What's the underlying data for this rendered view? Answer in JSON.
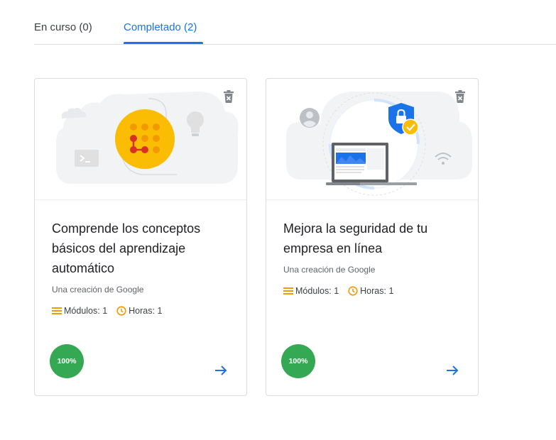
{
  "tabs": [
    {
      "label": "En curso (0)",
      "active": false
    },
    {
      "label": "Completado (2)",
      "active": true
    }
  ],
  "colors": {
    "accent": "#1a73e8",
    "progress": "#34a853",
    "meta_icon": "#f29900"
  },
  "courses": [
    {
      "title": "Comprende los conceptos básicos del aprendizaje automático",
      "creator": "Una creación de Google",
      "modules": "Módulos: 1",
      "hours": "Horas: 1",
      "progress": "100%",
      "progress_fraction": 1.0,
      "illustration": "machine-learning-illustration",
      "delete_icon": "trash-icon",
      "open_icon": "arrow-forward-icon"
    },
    {
      "title": "Mejora la seguridad de tu empresa en línea",
      "creator": "Una creación de Google",
      "modules": "Módulos: 1",
      "hours": "Horas: 1",
      "progress": "100%",
      "progress_fraction": 1.0,
      "illustration": "online-security-illustration",
      "delete_icon": "trash-icon",
      "open_icon": "arrow-forward-icon"
    }
  ]
}
